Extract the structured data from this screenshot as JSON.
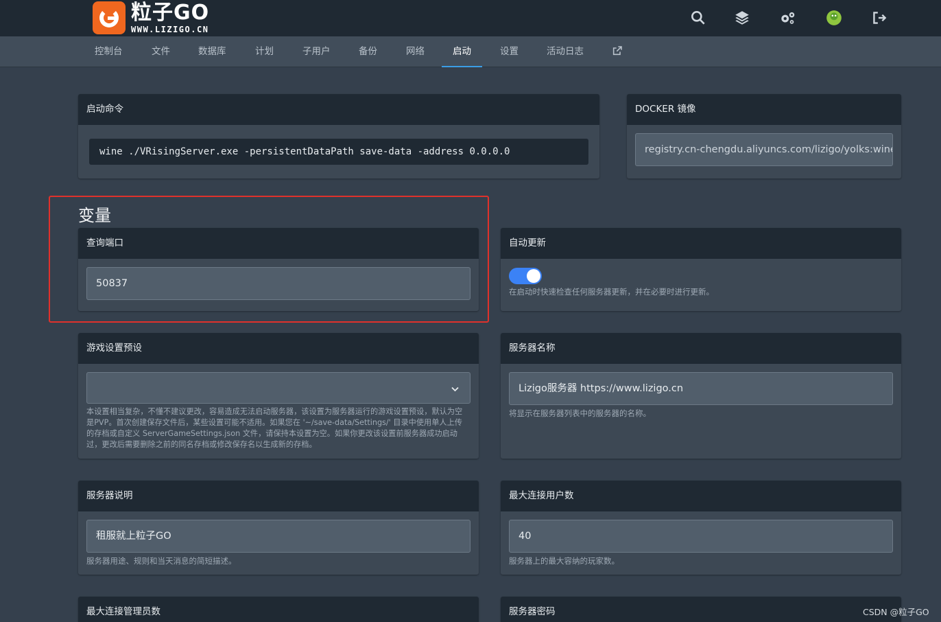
{
  "brand": {
    "title": "粒子GO",
    "url": "WWW.LIZIGO.CN",
    "accent": "#f0671f"
  },
  "topbar": {
    "icons": [
      "search-icon",
      "layers-icon",
      "cogs-icon",
      "avatar",
      "logout-icon"
    ]
  },
  "nav": {
    "items": [
      "控制台",
      "文件",
      "数据库",
      "计划",
      "子用户",
      "备份",
      "网络",
      "启动",
      "设置",
      "活动日志"
    ],
    "active": "启动",
    "external_icon": "external-link-icon"
  },
  "startup": {
    "title": "启动命令",
    "command": "wine ./VRisingServer.exe -persistentDataPath save-data -address 0.0.0.0"
  },
  "docker": {
    "title": "DOCKER 镜像",
    "image": "registry.cn-chengdu.aliyuncs.com/lizigo/yolks:wine_"
  },
  "variables": {
    "heading": "变量",
    "query_port": {
      "label": "查询端口",
      "value": "50837"
    },
    "auto_update": {
      "label": "自动更新",
      "enabled": true,
      "help": "在启动时快速检查任何服务器更新，并在必要时进行更新。"
    },
    "game_preset": {
      "label": "游戏设置预设",
      "value": "",
      "help": "本设置相当复杂，不懂不建议更改，容易造成无法启动服务器，该设置为服务器运行的游戏设置预设，默认为空是PVP。首次创建保存文件后，某些设置可能不适用。如果您在 '~/save-data/Settings/' 目录中使用单人上传的存档或自定义 ServerGameSettings.json 文件，请保持本设置为空。如果你更改该设置前服务器成功启动过，更改后需要删除之前的同名存档或修改保存名以生成新的存档。"
    },
    "server_name": {
      "label": "服务器名称",
      "value": "Lizigo服务器 https://www.lizigo.cn",
      "help": "将显示在服务器列表中的服务器的名称。"
    },
    "server_desc": {
      "label": "服务器说明",
      "value": "租服就上粒子GO",
      "help": "服务器用途、规则和当天消息的简短描述。"
    },
    "max_users": {
      "label": "最大连接用户数",
      "value": "40",
      "help": "服务器上的最大容纳的玩家数。"
    },
    "max_admins": {
      "label": "最大连接管理员数"
    },
    "server_password": {
      "label": "服务器密码"
    }
  },
  "watermark": "CSDN @粒子GO"
}
